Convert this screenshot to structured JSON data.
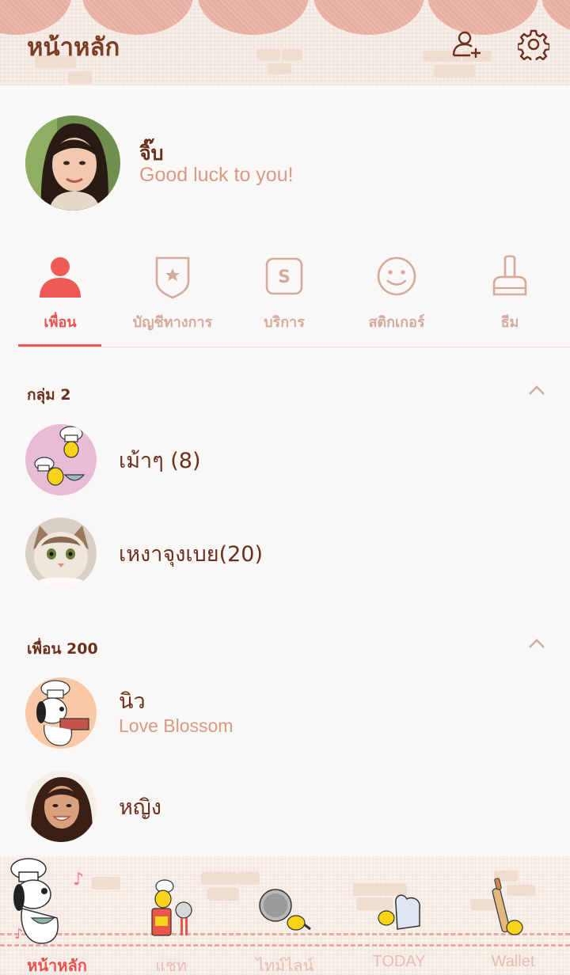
{
  "header": {
    "title": "หน้าหลัก",
    "add_friend_icon": "person-plus-icon",
    "settings_icon": "gear-icon"
  },
  "profile": {
    "name": "จิ๊บ",
    "status": "Good luck to you!"
  },
  "tabs": [
    {
      "label": "เพื่อน",
      "icon": "person-icon",
      "active": true
    },
    {
      "label": "บัญชีทางการ",
      "icon": "shield-star-icon",
      "active": false
    },
    {
      "label": "บริการ",
      "icon": "service-s-icon",
      "active": false
    },
    {
      "label": "สติกเกอร์",
      "icon": "smiley-icon",
      "active": false
    },
    {
      "label": "ธีม",
      "icon": "brush-icon",
      "active": false
    }
  ],
  "groups": {
    "title": "กลุ่ม 2",
    "items": [
      {
        "name": "เม้าๆ (8)"
      },
      {
        "name": "เหงาจุงเบย(20)"
      }
    ]
  },
  "friends": {
    "title": "เพื่อน 200",
    "items": [
      {
        "name": "นิว",
        "status": "Love Blossom"
      },
      {
        "name": "หญิง"
      }
    ]
  },
  "bottom_nav": [
    {
      "label": "หน้าหลัก",
      "active": true
    },
    {
      "label": "แชท",
      "active": false
    },
    {
      "label": "ไทม์ไลน์",
      "active": false
    },
    {
      "label": "TODAY",
      "active": false
    },
    {
      "label": "Wallet",
      "active": false
    }
  ],
  "colors": {
    "accent": "#e9534f",
    "brown": "#6b2f1d",
    "muted_pink": "#d89a82"
  }
}
